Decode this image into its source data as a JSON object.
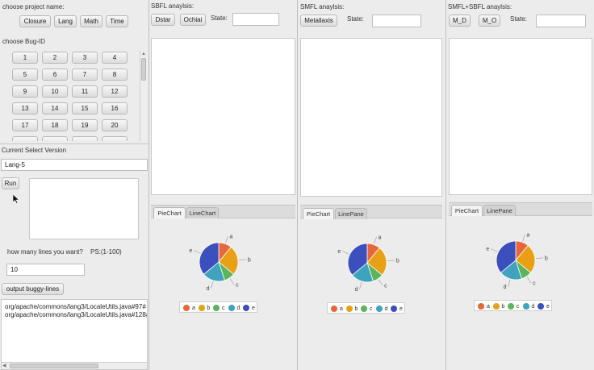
{
  "left": {
    "project_label": "choose project name:",
    "projects": [
      "Closure",
      "Lang",
      "Math",
      "Time"
    ],
    "bug_label": "choose Bug-ID",
    "bug_ids": [
      "1",
      "2",
      "3",
      "4",
      "5",
      "6",
      "7",
      "8",
      "9",
      "10",
      "11",
      "12",
      "13",
      "14",
      "15",
      "16",
      "17",
      "18",
      "19",
      "20"
    ],
    "current_version_label": "Current Select Version",
    "current_version_value": "Lang-5",
    "run_label": "Run",
    "lines_label": "how many lines you want?",
    "lines_hint": "PS:(1-100)",
    "lines_value": "10",
    "output_label": "output  buggy-lines",
    "output_lines": [
      "org/apache/commons/lang3/LocaleUtils.java#97#",
      "org/apache/commons/lang3/LocaleUtils.java#128#"
    ]
  },
  "panels": [
    {
      "title": "SBFL anaylsis:",
      "buttons": [
        "Dstar",
        "Ochiai"
      ],
      "state_label": "State:",
      "tabs": [
        "PieChart",
        "LineChart"
      ],
      "active_tab": 0
    },
    {
      "title": "SMFL anaylsis:",
      "buttons": [
        "Metallaxis"
      ],
      "state_label": "State:",
      "tabs": [
        "PieChart",
        "LinePane"
      ],
      "active_tab": 0
    },
    {
      "title": "SMFL+SBFL anaylsis:",
      "buttons": [
        "M_D",
        "M_O"
      ],
      "state_label": "State:",
      "tabs": [
        "PieChart",
        "LinePane"
      ],
      "active_tab": 0
    }
  ],
  "colors": {
    "a": "#e8673a",
    "b": "#e8a117",
    "c": "#5cb45c",
    "d": "#3fa3bd",
    "e": "#3b4fbd"
  },
  "chart_data": [
    {
      "type": "pie",
      "categories": [
        "a",
        "b",
        "c",
        "d",
        "e"
      ],
      "values": [
        11,
        25,
        9,
        19,
        36
      ],
      "legend": "bottom"
    },
    {
      "type": "pie",
      "categories": [
        "a",
        "b",
        "c",
        "d",
        "e"
      ],
      "values": [
        11,
        25,
        9,
        19,
        36
      ],
      "legend": "bottom"
    },
    {
      "type": "pie",
      "categories": [
        "a",
        "b",
        "c",
        "d",
        "e"
      ],
      "values": [
        11,
        25,
        9,
        19,
        36
      ],
      "legend": "bottom"
    }
  ]
}
